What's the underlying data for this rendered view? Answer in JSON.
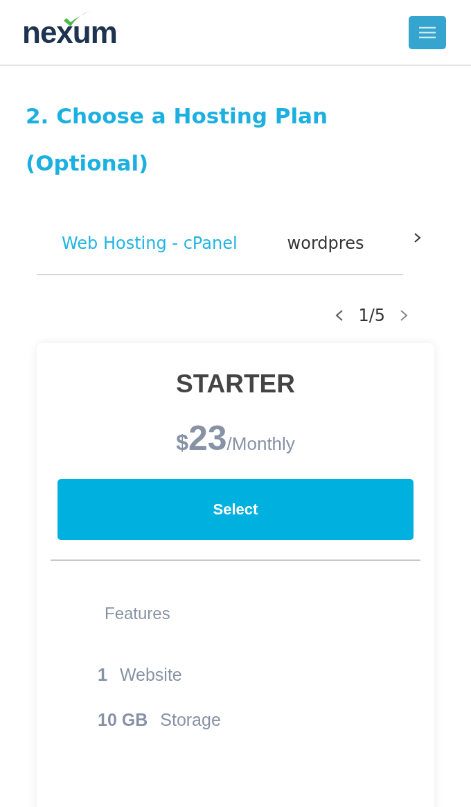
{
  "header": {
    "logo": "nexum"
  },
  "heading": "2. Choose a Hosting Plan (Optional)",
  "tabs": [
    {
      "label": "Web Hosting - cPanel",
      "selected": true
    },
    {
      "label": "wordpres",
      "selected": false
    }
  ],
  "pager": {
    "text": "1/5"
  },
  "plan": {
    "name": "STARTER",
    "currency": "$",
    "price": "23",
    "period": "/Monthly",
    "button": "Select",
    "features_title": "Features",
    "features": [
      {
        "value": "1",
        "label": "Website"
      },
      {
        "value": "10 GB",
        "label": "Storage"
      }
    ]
  }
}
